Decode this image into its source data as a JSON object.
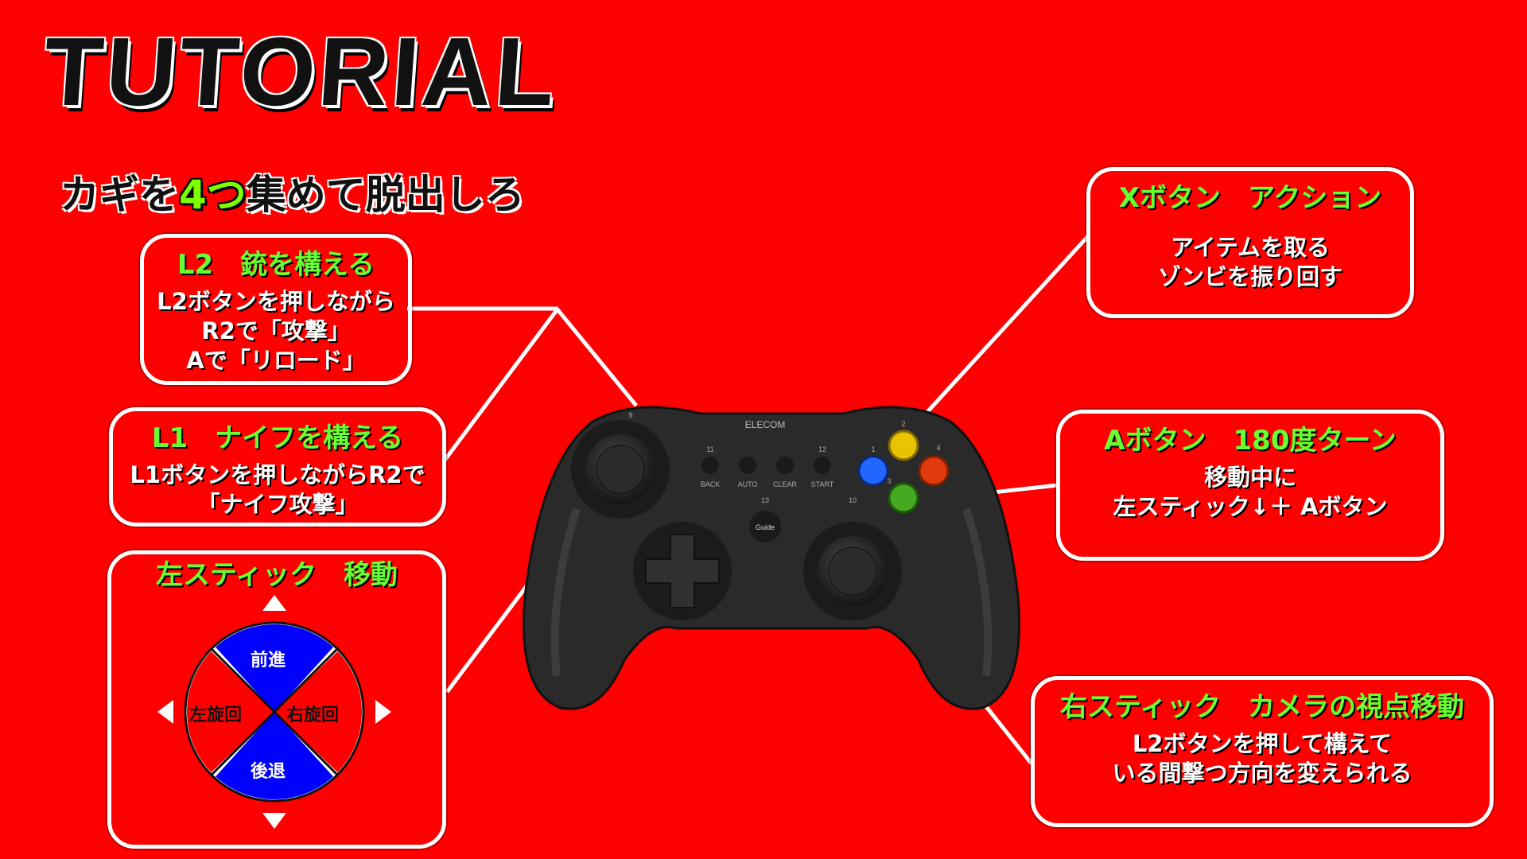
{
  "title": "TUTORIAL",
  "subtitle": {
    "before": "カギを",
    "num": "4つ",
    "after": "集めて脱出しろ"
  },
  "boxes": {
    "l2": {
      "head": "L2　銃を構える",
      "body": "L2ボタンを押しながら\nR2で「攻撃」\nAで「リロード」"
    },
    "l1": {
      "head": "L1　ナイフを構える",
      "body": "L1ボタンを押しながらR2で\n「ナイフ攻撃」"
    },
    "left_stick": {
      "head": "左スティック　移動"
    },
    "x": {
      "head": "Xボタン　アクション",
      "body": "アイテムを取る\nゾンビを振り回す"
    },
    "a": {
      "head": "Aボタン　180度ターン",
      "body": "移動中に\n左スティック↓＋ Aボタン"
    },
    "right_stick": {
      "head": "右スティック　カメラの視点移動",
      "body": "L2ボタンを押して構えて\nいる間撃つ方向を変えられる"
    }
  },
  "stick_diagram": {
    "forward": "前進",
    "back": "後退",
    "left": "左旋回",
    "right": "右旋回"
  },
  "controller": {
    "brand": "ELECOM",
    "buttons": [
      "BACK",
      "AUTO",
      "CLEAR",
      "START"
    ],
    "guide": "Guide",
    "numbers": {
      "n9": "9",
      "n11": "11",
      "n12": "12",
      "n13": "13",
      "n10": "10",
      "n1": "1",
      "n2": "2",
      "n3": "3",
      "n4": "4"
    }
  },
  "colors": {
    "background": "#ff0000",
    "heading": "#66ff33",
    "blue": "#0000ff"
  }
}
